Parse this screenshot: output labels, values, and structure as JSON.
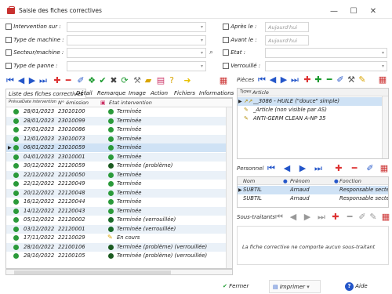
{
  "window": {
    "title": "Saisie des fiches correctives",
    "minimize": "—",
    "maximize": "☐",
    "close": "✕"
  },
  "filters": {
    "intervention": "Intervention sur :",
    "machine_type": "Type de machine :",
    "sector": "Secteur/machine :",
    "breakdown_type": "Type de panne :",
    "after": "Après le :",
    "before": "Avant le :",
    "state": "Etat :",
    "locked": "Verrouillé :",
    "after_value": "Aujourd'hui",
    "before_value": "Aujourd'hui"
  },
  "tabs": [
    "Liste des fiches correctives",
    "Détail",
    "Remarque",
    "Image",
    "Action",
    "Fichiers",
    "Informations"
  ],
  "grid": {
    "columns": [
      "Prévue",
      "Date intervention",
      "N° émission",
      "Etat intervention"
    ],
    "rows": [
      {
        "date": "28/01/2023",
        "num": "23010100",
        "status": "Terminée",
        "kind": "ok"
      },
      {
        "date": "28/01/2023",
        "num": "23010099",
        "status": "Terminée",
        "kind": "ok"
      },
      {
        "date": "27/01/2023",
        "num": "23010086",
        "status": "Terminée",
        "kind": "ok"
      },
      {
        "date": "12/01/2023",
        "num": "23010073",
        "status": "Terminée",
        "kind": "ok"
      },
      {
        "date": "06/01/2023",
        "num": "23010059",
        "status": "Terminée",
        "kind": "ok"
      },
      {
        "date": "04/01/2023",
        "num": "23010001",
        "status": "Terminée",
        "kind": "ok"
      },
      {
        "date": "30/12/2022",
        "num": "22120059",
        "status": "Terminée (problème)",
        "kind": "prob"
      },
      {
        "date": "22/12/2022",
        "num": "22120050",
        "status": "Terminée",
        "kind": "ok"
      },
      {
        "date": "22/12/2022",
        "num": "22120049",
        "status": "Terminée",
        "kind": "ok"
      },
      {
        "date": "20/12/2022",
        "num": "22120048",
        "status": "Terminée",
        "kind": "ok"
      },
      {
        "date": "16/12/2022",
        "num": "22120044",
        "status": "Terminée",
        "kind": "ok"
      },
      {
        "date": "14/12/2022",
        "num": "22120043",
        "status": "Terminée",
        "kind": "ok"
      },
      {
        "date": "05/12/2022",
        "num": "22120002",
        "status": "Terminée (verrouillée)",
        "kind": "lock"
      },
      {
        "date": "03/12/2022",
        "num": "22120001",
        "status": "Terminée (verrouillée)",
        "kind": "lock"
      },
      {
        "date": "17/11/2022",
        "num": "22110029",
        "status": "En cours",
        "kind": "en"
      },
      {
        "date": "28/10/2022",
        "num": "22100106",
        "status": "Terminée (problème) (verrouillée)",
        "kind": "prob"
      },
      {
        "date": "28/10/2022",
        "num": "22100105",
        "status": "Terminée (problème) (verrouillée)",
        "kind": "prob"
      }
    ]
  },
  "pieces": {
    "label": "Pièces",
    "columns": [
      "Types",
      "Article"
    ],
    "rows": [
      {
        "type": "↗↗",
        "article": "__3086 - HUILE (\"douce\" simple)"
      },
      {
        "type": "✎",
        "article": "_Article (non visible par AS)"
      },
      {
        "type": "✎",
        "article": "ANTI-GERM CLEAN A-NP 35"
      }
    ]
  },
  "personnel": {
    "label": "Personnel",
    "columns": [
      "Nom",
      "Prénom",
      "Fonction"
    ],
    "rows": [
      {
        "nom": "SUBTIL",
        "prenom": "Arnaud",
        "fonction": "Responsable secteur"
      },
      {
        "nom": "SUBTIL",
        "prenom": "Arnaud",
        "fonction": "Responsable secteur"
      }
    ]
  },
  "subcontractors": {
    "label": "Sous-traitants",
    "empty_message": "La fiche corrective ne comporte aucun sous-traitant"
  },
  "buttons": {
    "close": "Fermer",
    "print": "Imprimer",
    "help": "Aide"
  }
}
